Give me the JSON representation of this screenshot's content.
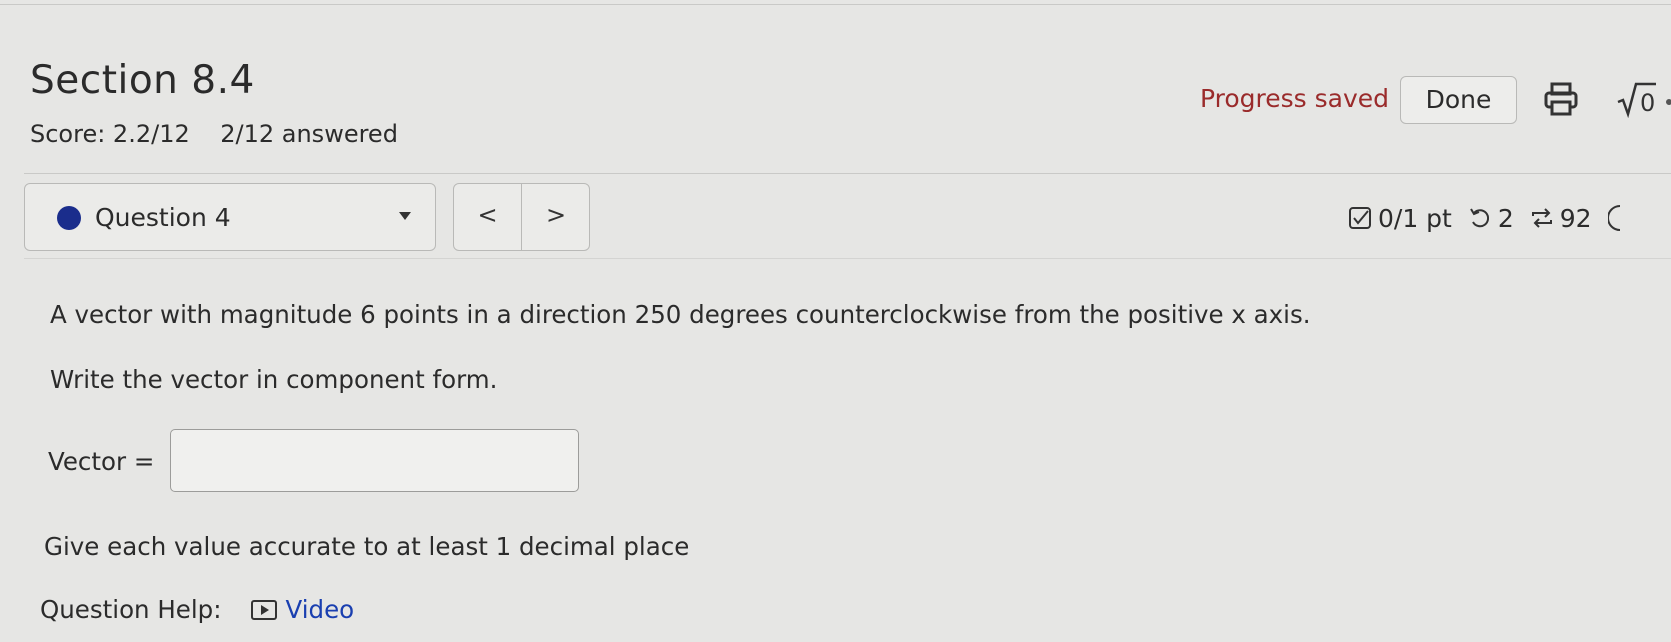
{
  "header": {
    "title": "Section 8.4",
    "score": "Score: 2.2/12    2/12 answered",
    "progress_status": "Progress saved",
    "done_label": "Done",
    "icons": [
      "print-icon",
      "sqrt-icon"
    ]
  },
  "question_nav": {
    "selected_question": "Question 4",
    "prev_label": "<",
    "next_label": ">"
  },
  "question_meta": {
    "points": "0/1 pt",
    "retries": "2",
    "attempts": "92"
  },
  "question": {
    "prompt": "A vector with magnitude 6 points in a direction 250 degrees counterclockwise from the positive x axis.",
    "instruction": "Write the vector in component form.",
    "answer_label": "Vector =",
    "answer_value": "",
    "hint": "Give each value accurate to at least 1 decimal place"
  },
  "help": {
    "label": "Question Help:",
    "video_label": "Video"
  },
  "colors": {
    "background": "#e6e6e4",
    "progress_text": "#9a2b2b",
    "question_dot": "#1a2d8c",
    "link": "#1a3fb0"
  }
}
